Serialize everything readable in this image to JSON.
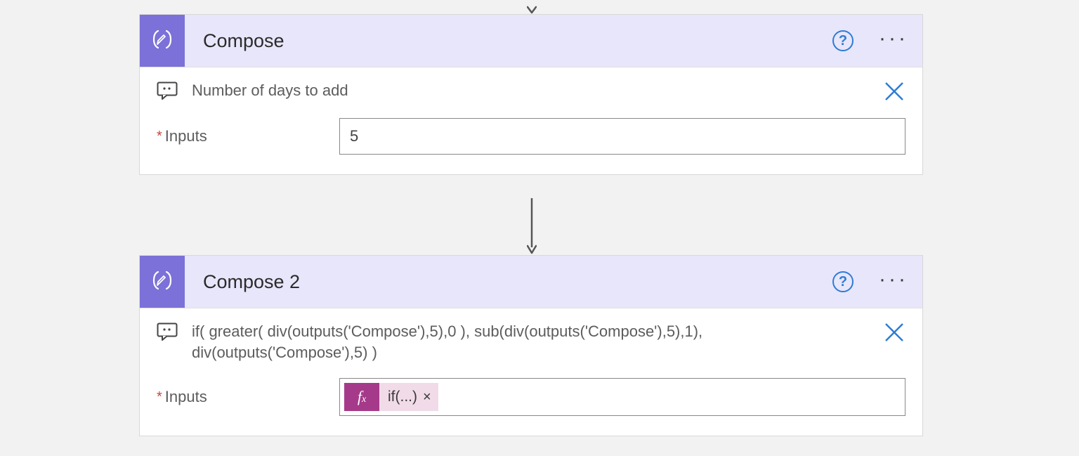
{
  "card1": {
    "title": "Compose",
    "commentText": "Number of days to add",
    "inputsLabel": "Inputs",
    "inputsValue": "5"
  },
  "card2": {
    "title": "Compose 2",
    "commentText": "if( greater( div(outputs('Compose'),5),0 ), sub(div(outputs('Compose'),5),1), div(outputs('Compose'),5) )",
    "inputsLabel": "Inputs",
    "tokenFx": "fx",
    "tokenLabel": "if(...)",
    "tokenRemove": "×"
  },
  "shared": {
    "helpGlyph": "?",
    "requiredMark": "*"
  }
}
